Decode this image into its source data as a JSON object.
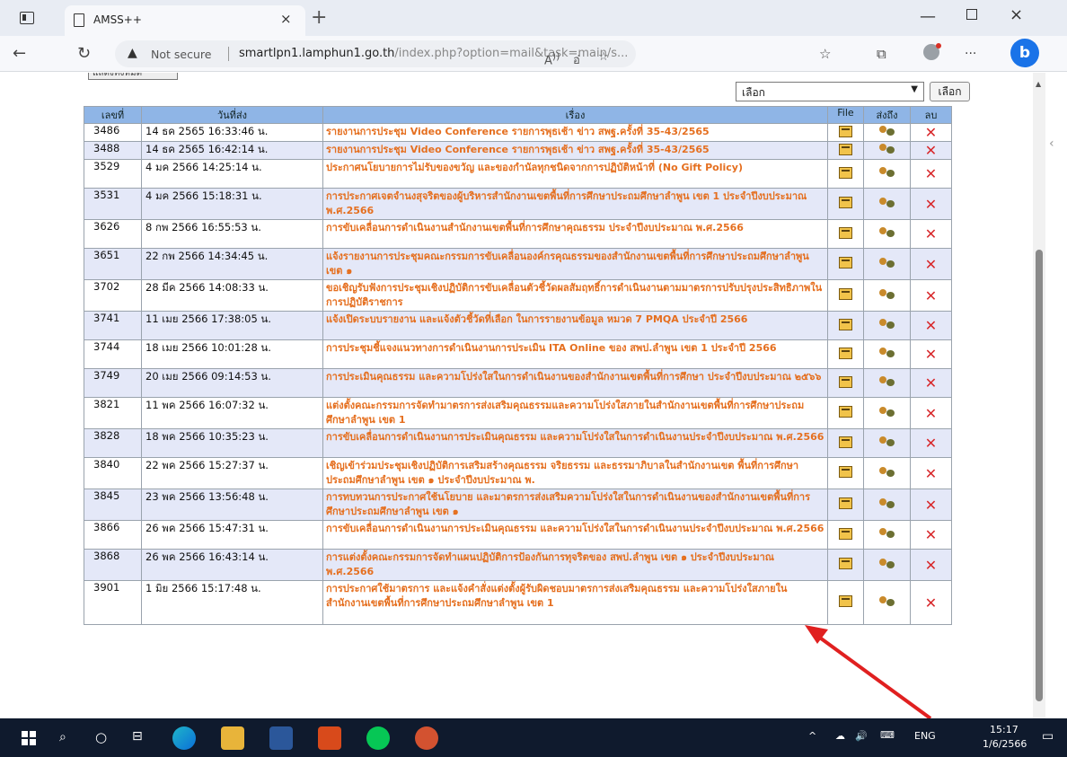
{
  "browser": {
    "tab_title": "AMSS++",
    "tab_close": "×",
    "new_tab": "+",
    "window_controls": {
      "minimize": "—",
      "close": "×"
    },
    "security_label": "Not secure",
    "url_host": "smartlpn1.lamphun1.go.th",
    "url_path": "/index.php?option=mail&task=main/s...",
    "profile_icon": "profile-icon",
    "copilot_label": "b"
  },
  "page": {
    "top_button_label": "แสดงทั้งหมด",
    "filter_select_value": "เลือก",
    "filter_button_label": "เลือก"
  },
  "table": {
    "headers": {
      "number": "เลขที่",
      "date": "วันที่ส่ง",
      "subject": "เรื่อง",
      "file": "File",
      "sent_to": "ส่งถึง",
      "delete": "ลบ"
    },
    "rows": [
      {
        "number": "3486",
        "date": "14 ธค 2565 16:33:46 น.",
        "subject": "รายงานการประชุม Video Conference รายการพุธเช้า ข่าว สพฐ.ครั้งที่ 35-43/2565"
      },
      {
        "number": "3488",
        "date": "14 ธค 2565 16:42:14 น.",
        "subject": "รายงานการประชุม Video Conference รายการพุธเช้า ข่าว สพฐ.ครั้งที่ 35-43/2565"
      },
      {
        "number": "3529",
        "date": "4 มค 2566 14:25:14 น.",
        "subject": "ประกาศนโยบายการไม่รับของขวัญ และของกำนัลทุกชนิดจากการปฏิบัติหน้าที่ (No Gift Policy)"
      },
      {
        "number": "3531",
        "date": "4 มค 2566 15:18:31 น.",
        "subject": "การประกาศเจตจำนงสุจริตของผู้บริหารสำนักงานเขตพื้นที่การศึกษาประถมศึกษาลำพูน เขต 1 ประจำปีงบประมาณ พ.ศ.2566"
      },
      {
        "number": "3626",
        "date": "8 กพ 2566 16:55:53 น.",
        "subject": "การขับเคลื่อนการดำเนินงานสำนักงานเขตพื้นที่การศึกษาคุณธรรม ประจำปีงบประมาณ พ.ศ.2566"
      },
      {
        "number": "3651",
        "date": "22 กพ 2566 14:34:45 น.",
        "subject": "แจ้งรายงานการประชุมคณะกรรมการขับเคลื่อนองค์กรคุณธรรมของสำนักงานเขตพื้นที่การศึกษาประถมศึกษาลำพูน เขต ๑"
      },
      {
        "number": "3702",
        "date": "28 มีค 2566 14:08:33 น.",
        "subject": "ขอเชิญรับฟังการประชุมเชิงปฏิบัติการขับเคลื่อนตัวชี้วัดผลสัมฤทธิ์การดำเนินงานตามมาตรการปรับปรุงประสิทธิภาพในการปฏิบัติราชการ"
      },
      {
        "number": "3741",
        "date": "11 เมย 2566 17:38:05 น.",
        "subject": "แจ้งเปิดระบบรายงาน และแจ้งตัวชี้วัดที่เลือก ในการรายงานข้อมูล หมวด 7 PMQA ประจำปี 2566"
      },
      {
        "number": "3744",
        "date": "18 เมย 2566 10:01:28 น.",
        "subject": "การประชุมชี้แจงแนวทางการดำเนินงานการประเมิน ITA Online ของ สพป.ลำพูน เขต 1 ประจำปี 2566"
      },
      {
        "number": "3749",
        "date": "20 เมย 2566 09:14:53 น.",
        "subject": "การประเมินคุณธรรม และความโปร่งใสในการดำเนินงานของสำนักงานเขตพื้นที่การศึกษา ประจำปีงบประมาณ ๒๕๖๖"
      },
      {
        "number": "3821",
        "date": "11 พค 2566 16:07:32 น.",
        "subject": "แต่งตั้งคณะกรรมการจัดทำมาตรการส่งเสริมคุณธรรมและความโปร่งใสภายในสำนักงานเขตพื้นที่การศึกษาประถมศึกษาลำพูน เขต 1"
      },
      {
        "number": "3828",
        "date": "18 พค 2566 10:35:23 น.",
        "subject": "การขับเคลื่อนการดำเนินงานการประเมินคุณธรรม และความโปร่งใสในการดำเนินงานประจำปีงบประมาณ พ.ศ.2566"
      },
      {
        "number": "3840",
        "date": "22 พค 2566 15:27:37 น.",
        "subject": "เชิญเข้าร่วมประชุมเชิงปฏิบัติการเสริมสร้างคุณธรรม จริยธรรม และธรรมาภิบาลในสำนักงานเขต พื้นที่การศึกษาประถมศึกษาลำพูน เขต ๑ ประจำปีงบประมาณ พ."
      },
      {
        "number": "3845",
        "date": "23 พค 2566 13:56:48 น.",
        "subject": "การทบทวนการประกาศใช้นโยบาย และมาตรการส่งเสริมความโปร่งใสในการดำเนินงานของสำนักงานเขตพื้นที่การศึกษาประถมศึกษาลำพูน เขต ๑"
      },
      {
        "number": "3866",
        "date": "26 พค 2566 15:47:31 น.",
        "subject": "การขับเคลื่อนการดำเนินงานการประเมินคุณธรรม และความโปร่งใสในการดำเนินงานประจำปีงบประมาณ พ.ศ.2566"
      },
      {
        "number": "3868",
        "date": "26 พค 2566 16:43:14 น.",
        "subject": "การแต่งตั้งคณะกรรมการจัดทำแผนปฏิบัติการป้องกันการทุจริตของ สพป.ลำพูน เขต ๑ ประจำปีงบประมาณ พ.ศ.2566"
      },
      {
        "number": "3901",
        "date": "1 มิย 2566 15:17:48 น.",
        "subject": "การประกาศใช้มาตรการ และแจ้งคำสั่งแต่งตั้งผู้รับผิดชอบมาตรการส่งเสริมคุณธรรม และความโปร่งใสภายในสำนักงานเขตพื้นที่การศึกษาประถมศึกษาลำพูน เขต 1"
      }
    ]
  },
  "taskbar": {
    "tray_language": "ENG",
    "clock_time": "15:17",
    "clock_date": "1/6/2566"
  },
  "colors": {
    "subject_text": "#e56f1f",
    "header_bg": "#8fb5e6",
    "even_row_bg": "#e4e8f8",
    "delete_icon": "#d8282b",
    "annotation_arrow": "#e02020"
  }
}
